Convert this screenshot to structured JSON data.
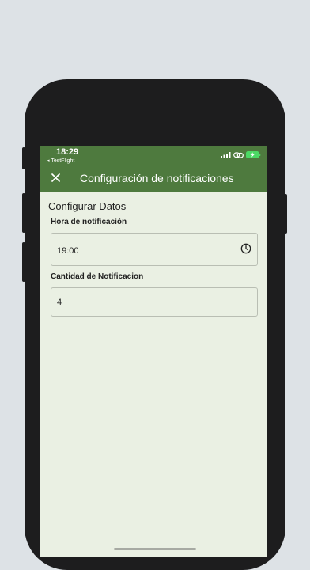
{
  "status_bar": {
    "time": "18:29",
    "back_app": "◂ TestFlight",
    "icons": [
      "signal-icon",
      "link-icon",
      "battery-charging-icon"
    ]
  },
  "app_bar": {
    "close_icon": "close-icon",
    "title": "Configuración de notificaciones",
    "color": "#4e7a3e"
  },
  "form": {
    "section_title": "Configurar Datos",
    "time_field": {
      "label": "Hora de notificación",
      "value": "19:00",
      "icon": "clock-icon"
    },
    "count_field": {
      "label": "Cantidad de Notificacion",
      "value": "4"
    }
  },
  "colors": {
    "background": "#eaf0e3",
    "accent": "#4e7a3e",
    "battery": "#4cd964"
  }
}
